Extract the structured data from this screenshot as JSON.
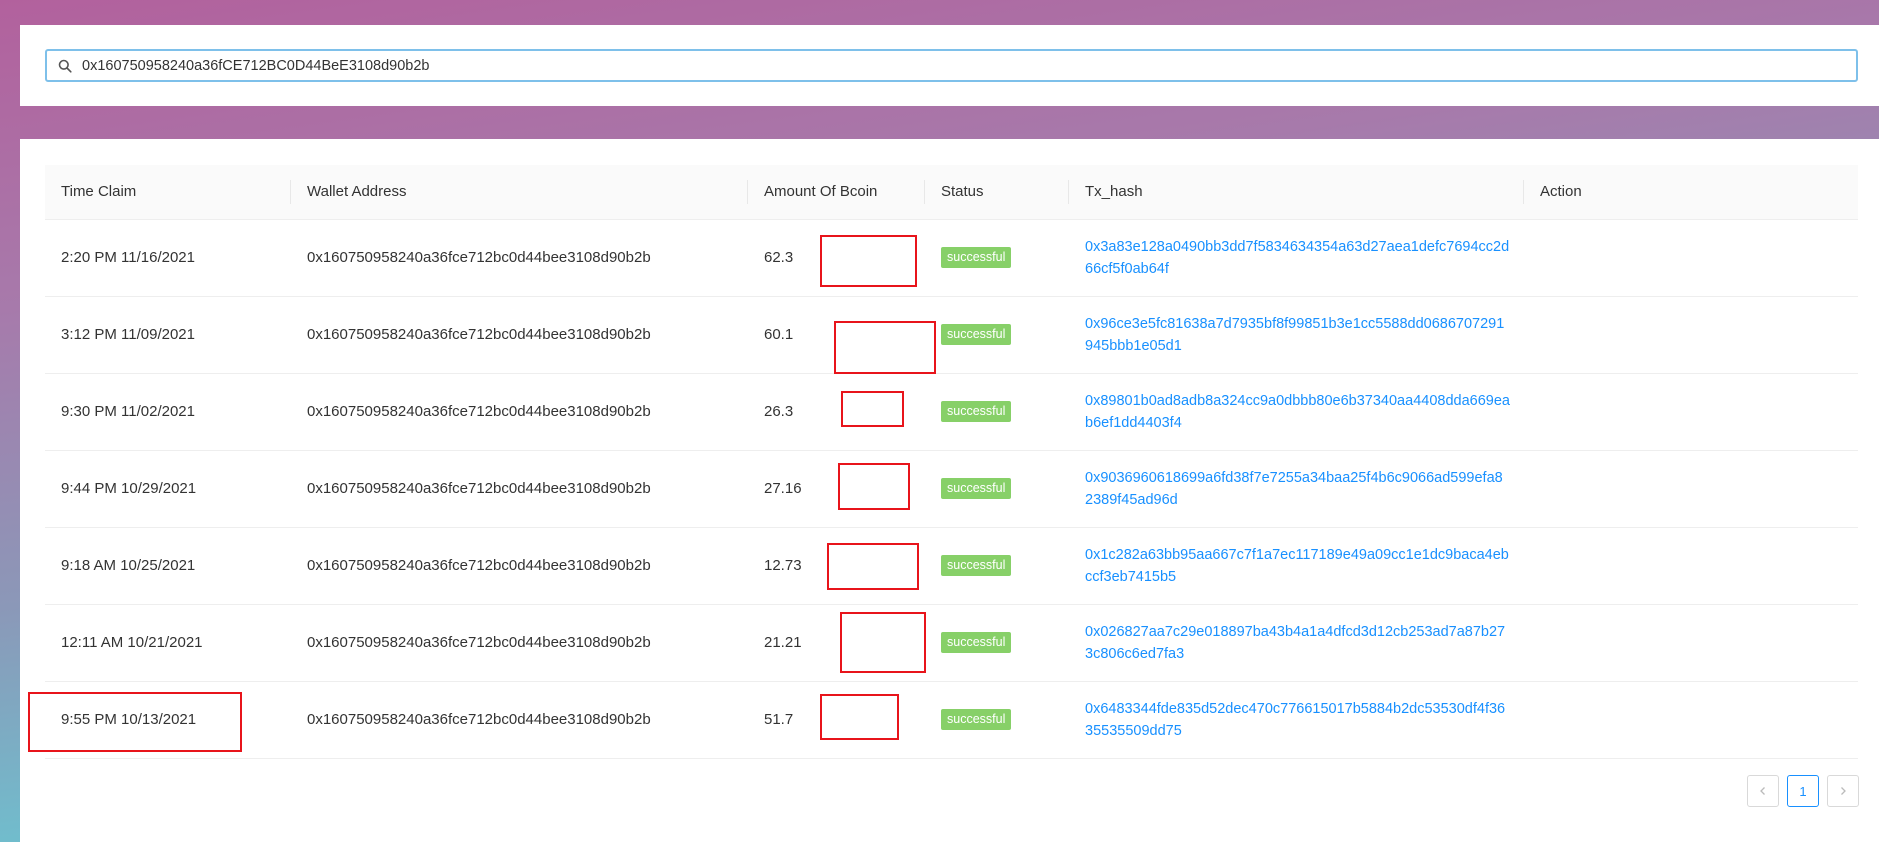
{
  "search": {
    "value": "0x160750958240a36fCE712BC0D44BeE3108d90b2b"
  },
  "table": {
    "columns": [
      "Time Claim",
      "Wallet Address",
      "Amount Of Bcoin",
      "Status",
      "Tx_hash",
      "Action"
    ],
    "rows": [
      {
        "time": "2:20 PM 11/16/2021",
        "wallet": "0x160750958240a36fce712bc0d44bee3108d90b2b",
        "amount": "62.3",
        "status": "successful",
        "tx": "0x3a83e128a0490bb3dd7f5834634354a63d27aea1defc7694cc2d66cf5f0ab64f"
      },
      {
        "time": "3:12 PM 11/09/2021",
        "wallet": "0x160750958240a36fce712bc0d44bee3108d90b2b",
        "amount": "60.1",
        "status": "successful",
        "tx": "0x96ce3e5fc81638a7d7935bf8f99851b3e1cc5588dd0686707291945bbb1e05d1"
      },
      {
        "time": "9:30 PM 11/02/2021",
        "wallet": "0x160750958240a36fce712bc0d44bee3108d90b2b",
        "amount": "26.3",
        "status": "successful",
        "tx": "0x89801b0ad8adb8a324cc9a0dbbb80e6b37340aa4408dda669eab6ef1dd4403f4"
      },
      {
        "time": "9:44 PM 10/29/2021",
        "wallet": "0x160750958240a36fce712bc0d44bee3108d90b2b",
        "amount": "27.16",
        "status": "successful",
        "tx": "0x9036960618699a6fd38f7e7255a34baa25f4b6c9066ad599efa82389f45ad96d"
      },
      {
        "time": "9:18 AM 10/25/2021",
        "wallet": "0x160750958240a36fce712bc0d44bee3108d90b2b",
        "amount": "12.73",
        "status": "successful",
        "tx": "0x1c282a63bb95aa667c7f1a7ec117189e49a09cc1e1dc9baca4ebccf3eb7415b5"
      },
      {
        "time": "12:11 AM 10/21/2021",
        "wallet": "0x160750958240a36fce712bc0d44bee3108d90b2b",
        "amount": "21.21",
        "status": "successful",
        "tx": "0x026827aa7c29e018897ba43b4a1a4dfcd3d12cb253ad7a87b273c806c6ed7fa3"
      },
      {
        "time": "9:55 PM 10/13/2021",
        "wallet": "0x160750958240a36fce712bc0d44bee3108d90b2b",
        "amount": "51.7",
        "status": "successful",
        "tx": "0x6483344fde835d52dec470c776615017b5884b2dc53530df4f3635535509dd75"
      }
    ]
  },
  "pagination": {
    "current": "1",
    "prev_icon": "chevron-left-icon",
    "next_icon": "chevron-right-icon"
  },
  "colors": {
    "success": "#87d068",
    "link": "#1890ff",
    "highlight": "#e8141b"
  }
}
